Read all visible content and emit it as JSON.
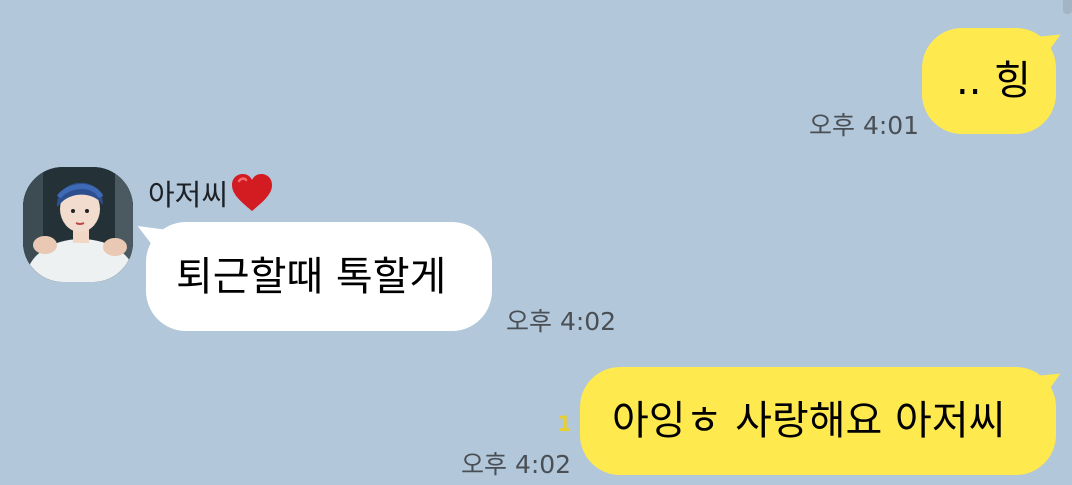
{
  "messages": [
    {
      "from": "me",
      "text": ".. 힝",
      "time": "오후 4:01"
    },
    {
      "from": "other",
      "sender": "아저씨",
      "sender_emoji": "red-heart",
      "text": "퇴근할때 톡할게",
      "time": "오후 4:02"
    },
    {
      "from": "me",
      "text": "아잉ㅎ 사랑해요 아저씨",
      "time": "오후 4:02",
      "unread_count": "1"
    }
  ],
  "colors": {
    "background": "#b2c7d9",
    "my_bubble": "#fee94f",
    "other_bubble": "#ffffff",
    "unread": "#e7cf32",
    "heart": "#d31b22"
  }
}
